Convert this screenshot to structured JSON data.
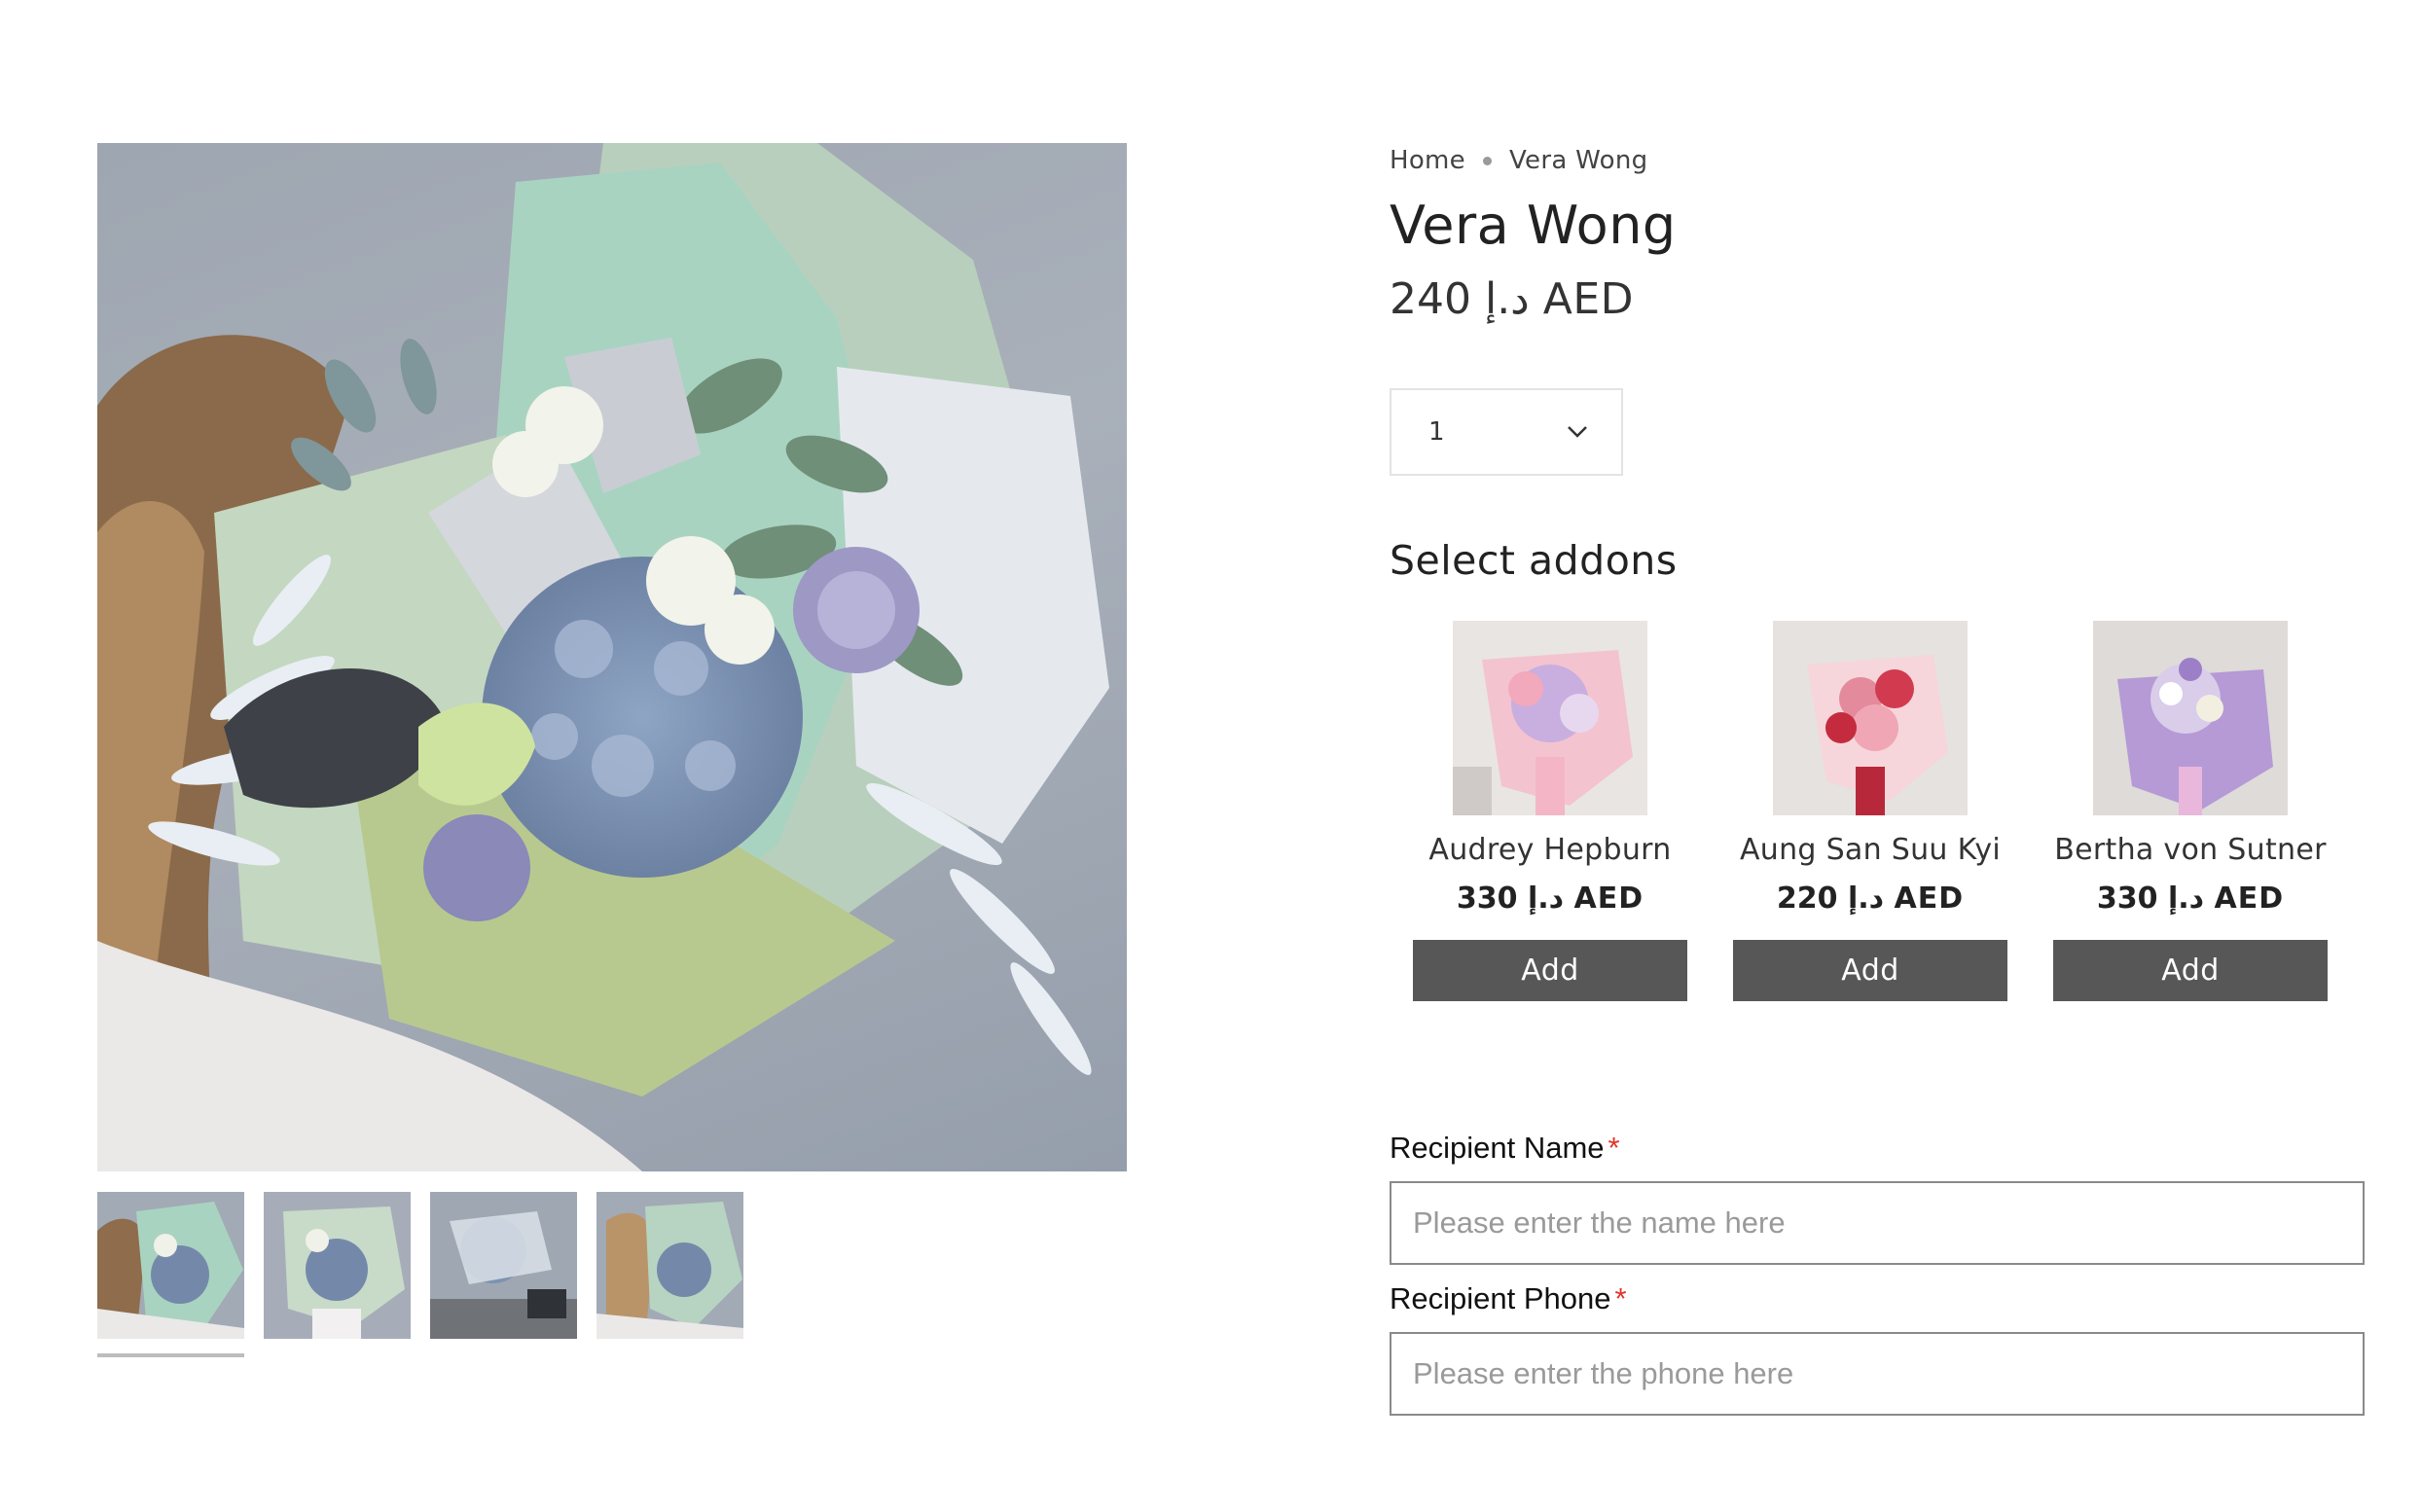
{
  "gallery": {
    "main_image_alt": "Vera Wong bouquet",
    "thumbnails": [
      "Vera Wong bouquet view 1",
      "Vera Wong bouquet view 2",
      "Vera Wong bouquet view 3",
      "Vera Wong bouquet view 4"
    ],
    "active_thumbnail": 1
  },
  "breadcrumb": {
    "home": "Home",
    "current": "Vera Wong"
  },
  "product": {
    "title": "Vera Wong",
    "price": "240 د.إ AED"
  },
  "quantity": {
    "selected": "1",
    "icon": "chevron-down-icon"
  },
  "addons": {
    "title": "Select addons",
    "items": [
      {
        "name": "Audrey Hepburn",
        "price": "330 د.إ AED",
        "button": "Add"
      },
      {
        "name": "Aung San Suu Kyi",
        "price": "220 د.إ AED",
        "button": "Add"
      },
      {
        "name": "Bertha von Sutner",
        "price": "330 د.إ AED",
        "button": "Add"
      }
    ]
  },
  "form": {
    "recipient_name": {
      "label": "Recipient Name",
      "required": "*",
      "placeholder": "Please enter the name here",
      "value": ""
    },
    "recipient_phone": {
      "label": "Recipient Phone",
      "required": "*",
      "placeholder": "Please enter the phone here",
      "value": ""
    }
  },
  "colors": {
    "button_bg": "#575757",
    "required": "#e0342a",
    "input_border": "#8a8a8a"
  }
}
